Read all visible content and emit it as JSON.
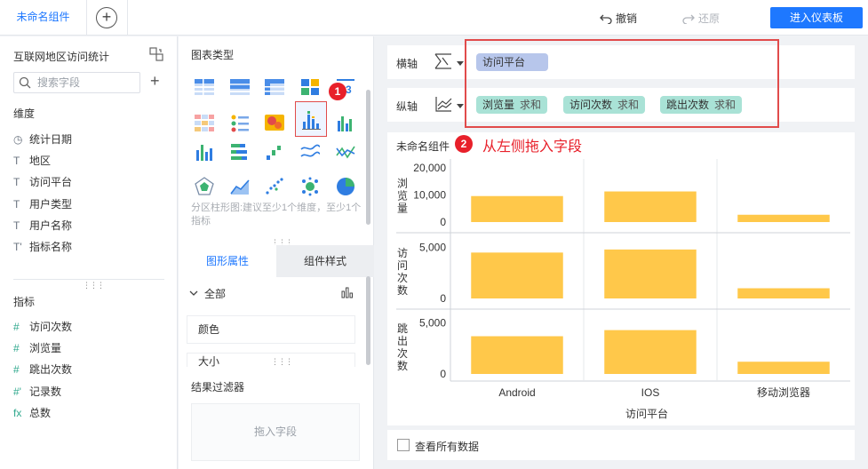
{
  "topbar": {
    "tab_label": "未命名组件",
    "undo_label": "撤销",
    "redo_label": "还原",
    "enter_dashboard_label": "进入仪表板"
  },
  "left_panel": {
    "dataset_title": "互联网地区访问统计",
    "search_placeholder": "搜索字段",
    "dimension_title": "维度",
    "dimensions": [
      {
        "icon": "◷",
        "label": "统计日期"
      },
      {
        "icon": "T",
        "label": "地区"
      },
      {
        "icon": "T",
        "label": "访问平台"
      },
      {
        "icon": "T",
        "label": "用户类型"
      },
      {
        "icon": "T",
        "label": "用户名称"
      },
      {
        "icon": "T'",
        "label": "指标名称"
      }
    ],
    "measure_title": "指标",
    "measures": [
      {
        "icon": "#",
        "label": "访问次数"
      },
      {
        "icon": "#",
        "label": "浏览量"
      },
      {
        "icon": "#",
        "label": "跳出次数"
      },
      {
        "icon": "#'",
        "label": "记录数"
      },
      {
        "icon": "fx",
        "label": "总数"
      }
    ]
  },
  "chart_types": {
    "title": "图表类型",
    "hint": "分区柱形图:建议至少1个维度，至少1个指标",
    "badge_1": "1"
  },
  "properties": {
    "tab_shape": "图形属性",
    "tab_style": "组件样式",
    "all_label": "全部",
    "color_label": "颜色",
    "size_label": "大小",
    "filter_title": "结果过滤器",
    "drop_field": "拖入字段"
  },
  "axes": {
    "x_label": "横轴",
    "x_fields": [
      {
        "name": "访问平台"
      }
    ],
    "y_label": "纵轴",
    "y_fields": [
      {
        "name": "浏览量",
        "agg": "求和"
      },
      {
        "name": "访问次数",
        "agg": "求和"
      },
      {
        "name": "跳出次数",
        "agg": "求和"
      }
    ],
    "badge_2": "2",
    "drag_tip": "从左侧拖入字段"
  },
  "chart_card": {
    "component_name": "未命名组件"
  },
  "chart_data": {
    "type": "bar",
    "categories": [
      "Android",
      "IOS",
      "移动浏览器"
    ],
    "xlabel": "访问平台",
    "bar_color": "#ffc84a",
    "panels": [
      {
        "ylabel": "浏览量",
        "ticks": [
          "20,000",
          "10,000",
          "0"
        ],
        "ylim": [
          0,
          20000
        ],
        "values": [
          9600,
          11300,
          2700
        ]
      },
      {
        "ylabel": "访问次数",
        "ticks": [
          "5,000",
          "0"
        ],
        "ylim": [
          0,
          5400
        ],
        "values": [
          4500,
          4800,
          1000
        ]
      },
      {
        "ylabel": "跳出次数",
        "ticks": [
          "5,000",
          "0"
        ],
        "ylim": [
          0,
          5400
        ],
        "values": [
          3700,
          4300,
          1200
        ]
      }
    ]
  },
  "footer": {
    "show_all_label": "查看所有数据"
  }
}
